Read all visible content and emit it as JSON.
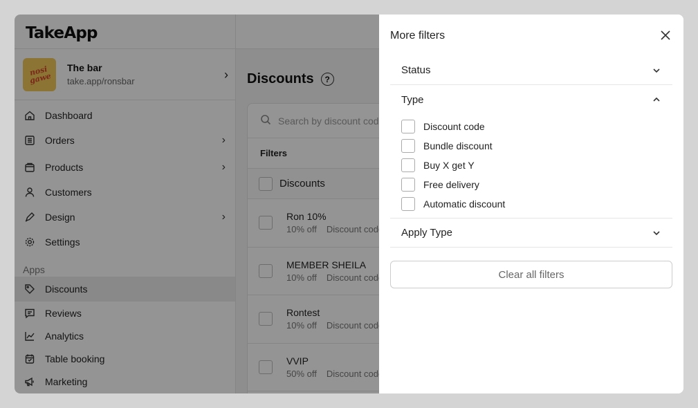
{
  "brand": "TakeApp",
  "store": {
    "name": "The bar",
    "url": "take.app/ronsbar",
    "avatar_text": "nosi gawe"
  },
  "nav": [
    {
      "label": "Dashboard",
      "icon": "home-icon",
      "chevron": false
    },
    {
      "label": "Orders",
      "icon": "orders-icon",
      "chevron": true
    },
    {
      "label": "Products",
      "icon": "products-icon",
      "chevron": true
    },
    {
      "label": "Customers",
      "icon": "user-icon",
      "chevron": false
    },
    {
      "label": "Design",
      "icon": "pen-icon",
      "chevron": true
    },
    {
      "label": "Settings",
      "icon": "gear-icon",
      "chevron": false
    }
  ],
  "apps_label": "Apps",
  "apps": [
    {
      "label": "Discounts",
      "icon": "tag-icon",
      "active": true
    },
    {
      "label": "Reviews",
      "icon": "chat-icon",
      "active": false
    },
    {
      "label": "Analytics",
      "icon": "chart-icon",
      "active": false
    },
    {
      "label": "Table booking",
      "icon": "calendar-icon",
      "active": false
    },
    {
      "label": "Marketing",
      "icon": "megaphone-icon",
      "active": false
    }
  ],
  "main": {
    "title": "Discounts",
    "search_placeholder": "Search by discount code",
    "filters_label": "Filters",
    "list_header": "Discounts",
    "rows": [
      {
        "title": "Ron 10%",
        "amount": "10% off",
        "kind": "Discount code"
      },
      {
        "title": "MEMBER SHEILA",
        "amount": "10% off",
        "kind": "Discount code"
      },
      {
        "title": "Rontest",
        "amount": "10% off",
        "kind": "Discount code"
      },
      {
        "title": "VVIP",
        "amount": "50% off",
        "kind": "Discount code"
      }
    ]
  },
  "drawer": {
    "title": "More filters",
    "sections": {
      "status": "Status",
      "type": "Type",
      "apply_type": "Apply Type"
    },
    "type_options": [
      "Discount code",
      "Bundle discount",
      "Buy X get Y",
      "Free delivery",
      "Automatic discount"
    ],
    "clear_label": "Clear all filters"
  }
}
